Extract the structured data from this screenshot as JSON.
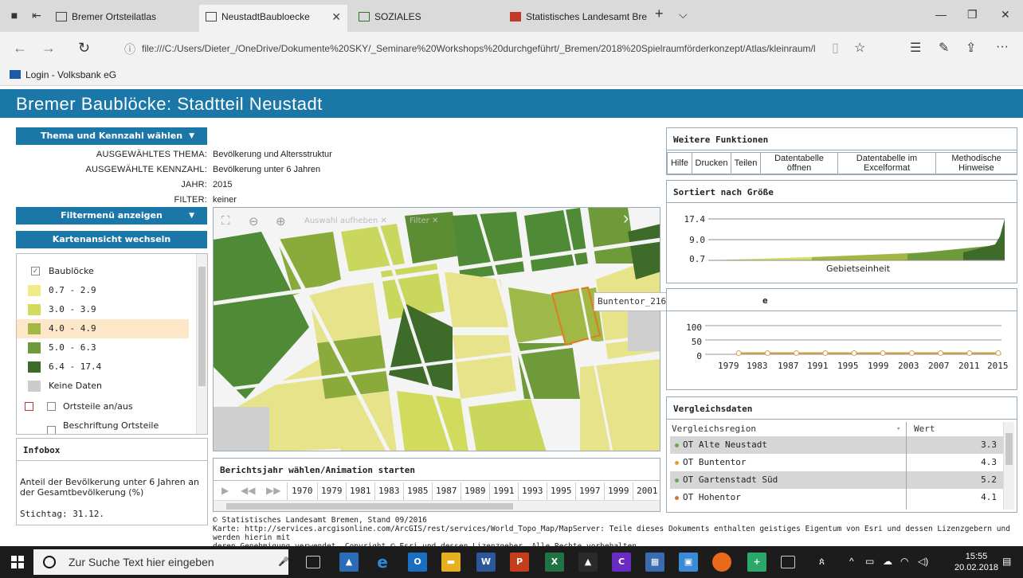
{
  "browser": {
    "tabs": [
      {
        "label": "Bremer Ortsteilatlas"
      },
      {
        "label": "NeustadtBaubloecke"
      },
      {
        "label": "SOZIALES"
      },
      {
        "label": "Statistisches Landesamt Bre"
      }
    ],
    "url": "file:///C:/Users/Dieter_/OneDrive/Dokumente%20SKY/_Seminare%20Workshops%20durchgeführt/_Bremen/2018%20Spielraumförderkonzept/Atlas/kleinraum/l",
    "favorite": "Login - Volksbank eG"
  },
  "app": {
    "title": "Bremer Baublöcke: Stadtteil Neustadt"
  },
  "left": {
    "theme_button": "Thema und Kennzahl wählen",
    "filter_button": "Filtermenü anzeigen",
    "view_button": "Kartenansicht wechseln",
    "info": [
      {
        "label": "AUSGEWÄHLTES THEMA:",
        "value": "Bevölkerung und Altersstruktur"
      },
      {
        "label": "AUSGEWÄHLTE KENNZAHL:",
        "value": "Bevölkerung unter 6 Jahren"
      },
      {
        "label": "JAHR:",
        "value": "2015"
      },
      {
        "label": "FILTER:",
        "value": "keiner"
      }
    ],
    "legend": {
      "layer": "Baublöcke",
      "classes": [
        {
          "label": "0.7 - 2.9",
          "color": "#f2eb8a"
        },
        {
          "label": "3.0 - 3.9",
          "color": "#d2db5e"
        },
        {
          "label": "4.0 - 4.9",
          "color": "#a2b845"
        },
        {
          "label": "5.0 - 6.3",
          "color": "#6e9a3a"
        },
        {
          "label": "6.4 - 17.4",
          "color": "#3f6b2a"
        },
        {
          "label": "Keine Daten",
          "color": "#cccccc"
        }
      ],
      "ortsteile_toggle": "Ortsteile an/aus",
      "beschriftung": "Beschriftung Ortsteile"
    },
    "infobox": {
      "title": "Infobox",
      "text": "Anteil der Bevölkerung unter 6 Jahren an der Gesamtbevölkerung (%)",
      "date": "Stichtag: 31.12."
    }
  },
  "map": {
    "tools": {
      "deselect": "Auswahl aufheben",
      "filter": "Filter"
    },
    "tooltip": "Buntentor_216009: 4.3",
    "year_panel_title": "Berichtsjahr wählen/Animation starten",
    "years": [
      "1970",
      "1979",
      "1981",
      "1983",
      "1985",
      "1987",
      "1989",
      "1991",
      "1993",
      "1995",
      "1997",
      "1999",
      "2001"
    ]
  },
  "footer": {
    "line1": "© Statistisches Landesamt Bremen, Stand 09/2016",
    "line2": "Karte: http://services.arcgisonline.com/ArcGIS/rest/services/World_Topo_Map/MapServer: Teile dieses Dokuments enthalten geistiges Eigentum von Esri und dessen Lizenzgebern und werden hierin mit",
    "line3": "deren Genehmigung verwendet. Copyright © Esri und dessen Lizenzgeber. Alle Rechte vorbehalten."
  },
  "right": {
    "functions_title": "Weitere Funktionen",
    "functions": [
      "Hilfe",
      "Drucken",
      "Teilen",
      "Datentabelle öffnen",
      "Datentabelle im Excelformat",
      "Methodische Hinweise"
    ],
    "sorted_title": "Sortiert nach Größe",
    "sorted_xlabel": "Gebietseinheit",
    "sorted_ticks": [
      "17.4",
      "9.0",
      "0.7"
    ],
    "timeline_title_fragment": "e",
    "timeline_yticks": [
      "100",
      "50",
      "0"
    ],
    "timeline_xticks": [
      "1979",
      "1983",
      "1987",
      "1991",
      "1995",
      "1999",
      "2003",
      "2007",
      "2011",
      "2015"
    ],
    "compare_title": "Vergleichsdaten",
    "compare_headers": [
      "Vergleichsregion",
      "Wert"
    ],
    "compare_rows": [
      {
        "name": "OT Alte Neustadt",
        "value": "3.3",
        "color": "#6aa84f"
      },
      {
        "name": "OT Buntentor",
        "value": "4.3",
        "color": "#e0a030"
      },
      {
        "name": "OT Gartenstadt Süd",
        "value": "5.2",
        "color": "#6aa84f"
      },
      {
        "name": "OT Hohentor",
        "value": "4.1",
        "color": "#d0703a"
      }
    ]
  },
  "chart_data": [
    {
      "type": "area",
      "title": "Sortiert nach Größe",
      "xlabel": "Gebietseinheit",
      "ylabel": "",
      "ylim": [
        0.7,
        17.4
      ],
      "yticks": [
        0.7,
        9.0,
        17.4
      ],
      "grid": true
    },
    {
      "type": "line",
      "ylim": [
        0,
        100
      ],
      "yticks": [
        0,
        50,
        100
      ],
      "x": [
        1979,
        1983,
        1987,
        1991,
        1995,
        1999,
        2003,
        2007,
        2011,
        2015
      ],
      "series": [
        {
          "values": [
            4,
            4,
            4,
            4,
            4,
            4,
            4,
            4,
            4,
            4
          ]
        }
      ],
      "grid": true
    }
  ],
  "taskbar": {
    "search_placeholder": "Zur Suche Text hier eingeben",
    "time": "15:55",
    "date": "20.02.2018"
  }
}
